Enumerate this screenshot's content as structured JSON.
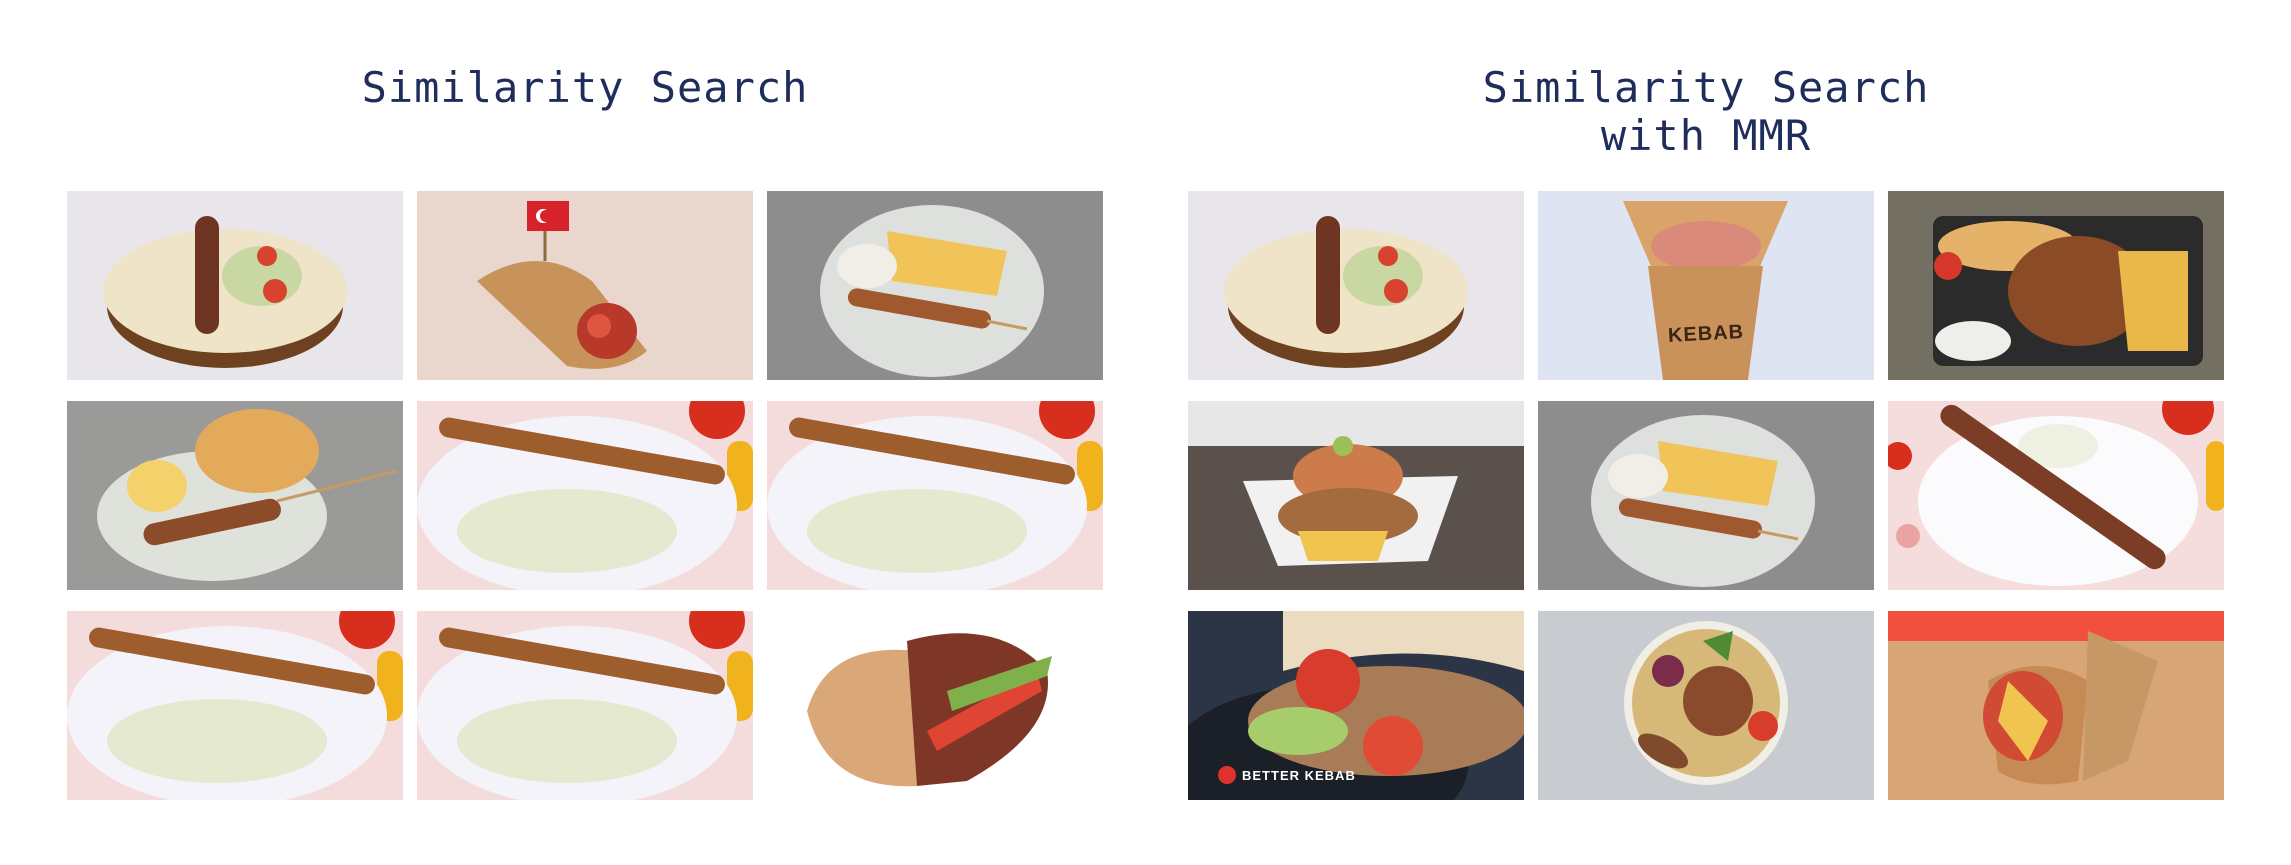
{
  "left_panel": {
    "title_lines": [
      "Similarity Search"
    ],
    "images": [
      {
        "name": "adana-kebab-on-flatbread"
      },
      {
        "name": "wrap-with-turkish-flag"
      },
      {
        "name": "skewer-with-fries-plate"
      },
      {
        "name": "skewer-with-bread-and-lemon"
      },
      {
        "name": "skewer-on-onion-plate"
      },
      {
        "name": "skewer-on-onion-plate"
      },
      {
        "name": "skewer-on-onion-plate"
      },
      {
        "name": "skewer-on-onion-plate"
      },
      {
        "name": "pita-kebab-sandwich"
      }
    ]
  },
  "right_panel": {
    "title_lines": [
      "Similarity Search",
      "with MMR"
    ],
    "images": [
      {
        "name": "adana-kebab-on-flatbread"
      },
      {
        "name": "kebab-box",
        "label": "KEBAB"
      },
      {
        "name": "kebab-platter-with-fries"
      },
      {
        "name": "kebab-plate-with-fries"
      },
      {
        "name": "skewer-with-fries-plate"
      },
      {
        "name": "meat-skewer-with-onion"
      },
      {
        "name": "doner-pita-closeup",
        "label": "BETTER KEBAB"
      },
      {
        "name": "mixed-grill-plate"
      },
      {
        "name": "wrap-with-fries"
      }
    ]
  }
}
